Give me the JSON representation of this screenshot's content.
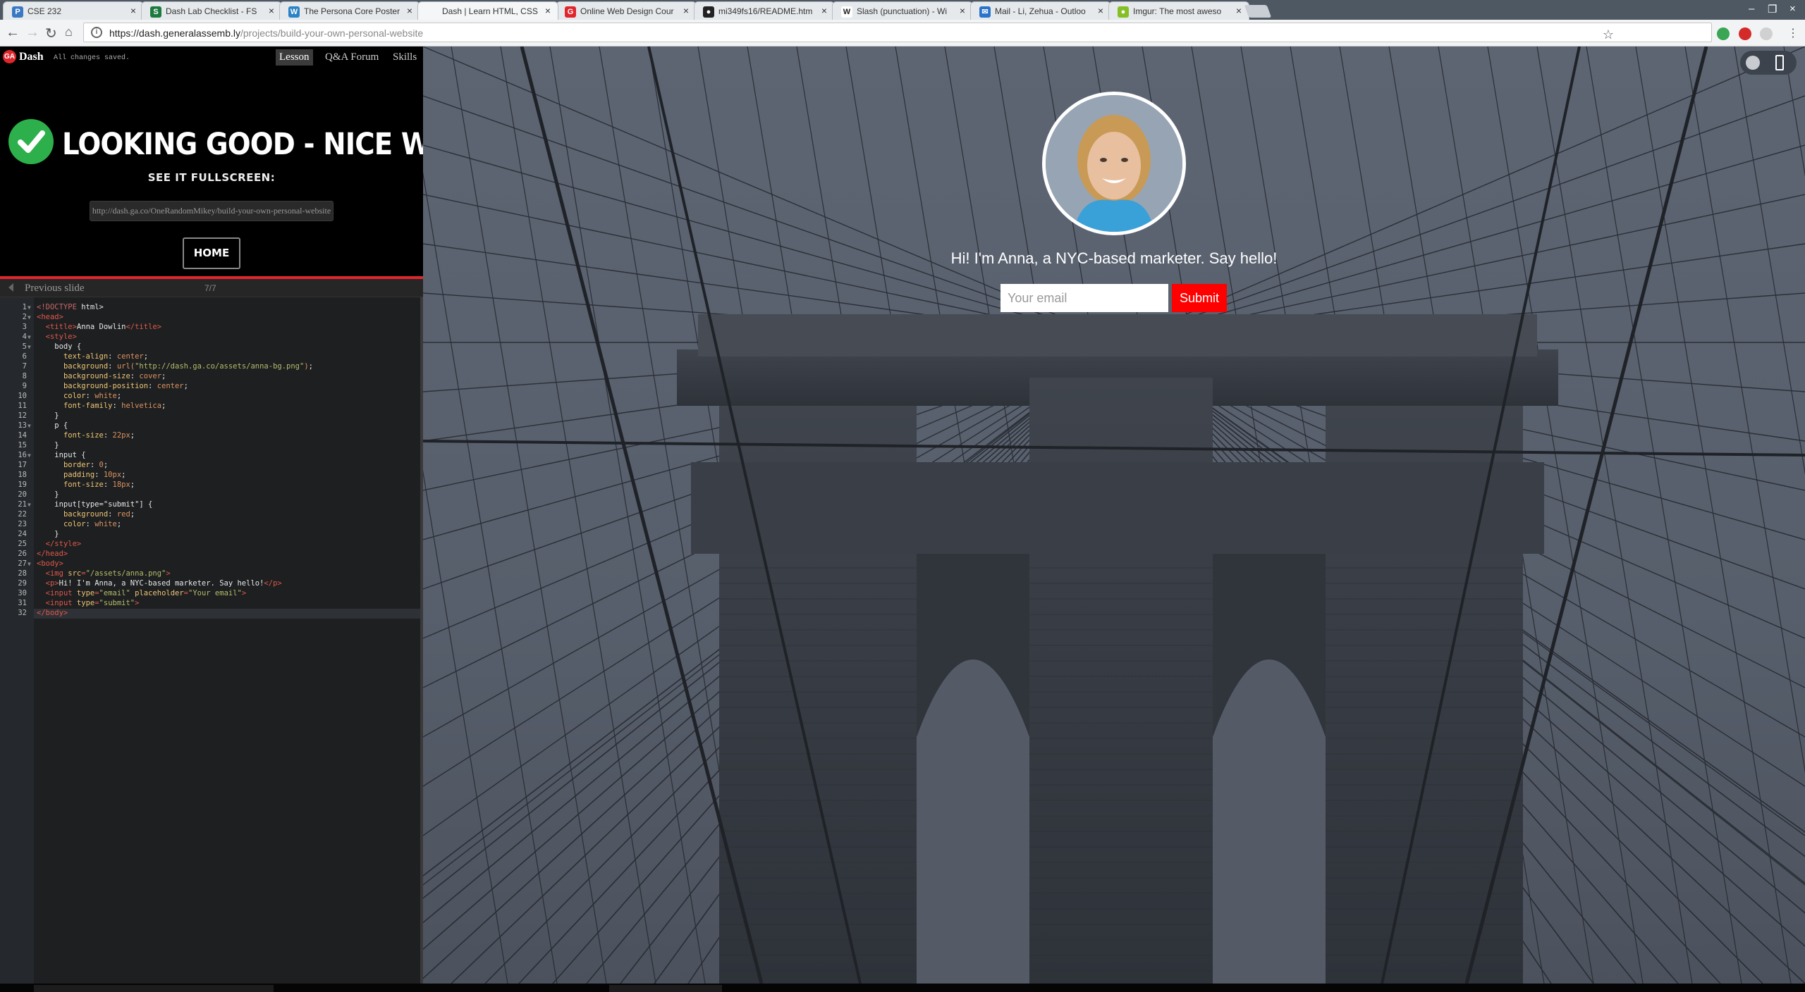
{
  "browser": {
    "tabs": [
      {
        "label": "CSE 232",
        "icon": "p-icon",
        "color": "#3b78c4"
      },
      {
        "label": "Dash Lab Checklist - FS",
        "icon": "s-icon",
        "color": "#1b7a3e"
      },
      {
        "label": "The Persona Core Poster",
        "icon": "wordpress-icon",
        "color": "#2b82c5"
      },
      {
        "label": "Dash | Learn HTML, CSS",
        "icon": "blank-icon",
        "color": "#f5f6f7"
      },
      {
        "label": "Online Web Design Cour",
        "icon": "ga-icon",
        "color": "#e0262d"
      },
      {
        "label": "mi349fs16/README.htm",
        "icon": "github-icon",
        "color": "#222222"
      },
      {
        "label": "Slash (punctuation) - Wi",
        "icon": "wikipedia-icon",
        "color": "#ffffff"
      },
      {
        "label": "Mail - Li, Zehua - Outloo",
        "icon": "mail-icon",
        "color": "#2b74c9"
      },
      {
        "label": "Imgur: The most aweso",
        "icon": "imgur-icon",
        "color": "#85bf25"
      }
    ],
    "url_host": "https://dash.generalassemb.ly",
    "url_path": "/projects/build-your-own-personal-website"
  },
  "lesson": {
    "app_name": "Dash",
    "save_status": "All changes saved.",
    "nav": [
      "Lesson",
      "Q&A Forum",
      "Skills"
    ],
    "headline": "LOOKING GOOD - NICE WORK!",
    "fullscreen_label": "SEE IT FULLSCREEN:",
    "share_url": "http://dash.ga.co/OneRandomMikey/build-your-own-personal-website",
    "home_label": "HOME",
    "prev_label": "Previous slide",
    "slide_count": "7/7"
  },
  "editor": {
    "lines": [
      [
        [
          "t-doc",
          "<!DOCTYPE"
        ],
        [
          "t-txt",
          " html>"
        ]
      ],
      [
        [
          "t-tag",
          "<head>"
        ]
      ],
      [
        [
          "t-txt",
          "  "
        ],
        [
          "t-tag",
          "<title>"
        ],
        [
          "t-txt",
          "Anna Dowlin"
        ],
        [
          "t-tag",
          "</title>"
        ]
      ],
      [
        [
          "t-txt",
          "  "
        ],
        [
          "t-tag",
          "<style>"
        ]
      ],
      [
        [
          "t-txt",
          "    body {"
        ]
      ],
      [
        [
          "t-txt",
          "      "
        ],
        [
          "t-prop",
          "text-align"
        ],
        [
          "t-txt",
          ": "
        ],
        [
          "t-val",
          "center"
        ],
        [
          "t-txt",
          ";"
        ]
      ],
      [
        [
          "t-txt",
          "      "
        ],
        [
          "t-prop",
          "background"
        ],
        [
          "t-txt",
          ": "
        ],
        [
          "t-val",
          "url("
        ],
        [
          "t-str",
          "\"http://dash.ga.co/assets/anna-bg.png\""
        ],
        [
          "t-val",
          ")"
        ],
        [
          "t-txt",
          ";"
        ]
      ],
      [
        [
          "t-txt",
          "      "
        ],
        [
          "t-prop",
          "background-size"
        ],
        [
          "t-txt",
          ": "
        ],
        [
          "t-val",
          "cover"
        ],
        [
          "t-txt",
          ";"
        ]
      ],
      [
        [
          "t-txt",
          "      "
        ],
        [
          "t-prop",
          "background-position"
        ],
        [
          "t-txt",
          ": "
        ],
        [
          "t-val",
          "center"
        ],
        [
          "t-txt",
          ";"
        ]
      ],
      [
        [
          "t-txt",
          "      "
        ],
        [
          "t-prop",
          "color"
        ],
        [
          "t-txt",
          ": "
        ],
        [
          "t-val",
          "white"
        ],
        [
          "t-txt",
          ";"
        ]
      ],
      [
        [
          "t-txt",
          "      "
        ],
        [
          "t-prop",
          "font-family"
        ],
        [
          "t-txt",
          ": "
        ],
        [
          "t-val",
          "helvetica"
        ],
        [
          "t-txt",
          ";"
        ]
      ],
      [
        [
          "t-txt",
          "    }"
        ]
      ],
      [
        [
          "t-txt",
          "    p {"
        ]
      ],
      [
        [
          "t-txt",
          "      "
        ],
        [
          "t-prop",
          "font-size"
        ],
        [
          "t-txt",
          ": "
        ],
        [
          "t-val",
          "22px"
        ],
        [
          "t-txt",
          ";"
        ]
      ],
      [
        [
          "t-txt",
          "    }"
        ]
      ],
      [
        [
          "t-txt",
          "    input {"
        ]
      ],
      [
        [
          "t-txt",
          "      "
        ],
        [
          "t-prop",
          "border"
        ],
        [
          "t-txt",
          ": "
        ],
        [
          "t-val",
          "0"
        ],
        [
          "t-txt",
          ";"
        ]
      ],
      [
        [
          "t-txt",
          "      "
        ],
        [
          "t-prop",
          "padding"
        ],
        [
          "t-txt",
          ": "
        ],
        [
          "t-val",
          "10px"
        ],
        [
          "t-txt",
          ";"
        ]
      ],
      [
        [
          "t-txt",
          "      "
        ],
        [
          "t-prop",
          "font-size"
        ],
        [
          "t-txt",
          ": "
        ],
        [
          "t-val",
          "18px"
        ],
        [
          "t-txt",
          ";"
        ]
      ],
      [
        [
          "t-txt",
          "    }"
        ]
      ],
      [
        [
          "t-txt",
          "    input[type=\"submit\"] {"
        ]
      ],
      [
        [
          "t-txt",
          "      "
        ],
        [
          "t-prop",
          "background"
        ],
        [
          "t-txt",
          ": "
        ],
        [
          "t-val",
          "red"
        ],
        [
          "t-txt",
          ";"
        ]
      ],
      [
        [
          "t-txt",
          "      "
        ],
        [
          "t-prop",
          "color"
        ],
        [
          "t-txt",
          ": "
        ],
        [
          "t-val",
          "white"
        ],
        [
          "t-txt",
          ";"
        ]
      ],
      [
        [
          "t-txt",
          "    }"
        ]
      ],
      [
        [
          "t-txt",
          "  "
        ],
        [
          "t-tag",
          "</style>"
        ]
      ],
      [
        [
          "t-tag",
          "</head>"
        ]
      ],
      [
        [
          "t-tag",
          "<body>"
        ]
      ],
      [
        [
          "t-txt",
          "  "
        ],
        [
          "t-tag",
          "<img "
        ],
        [
          "t-prop",
          "src"
        ],
        [
          "t-tag",
          "="
        ],
        [
          "t-str",
          "\"/assets/anna.png\""
        ],
        [
          "t-tag",
          ">"
        ]
      ],
      [
        [
          "t-txt",
          "  "
        ],
        [
          "t-tag",
          "<p>"
        ],
        [
          "t-txt",
          "Hi! I'm Anna, a NYC-based marketer. Say hello!"
        ],
        [
          "t-tag",
          "</p>"
        ]
      ],
      [
        [
          "t-txt",
          "  "
        ],
        [
          "t-tag",
          "<input "
        ],
        [
          "t-prop",
          "type"
        ],
        [
          "t-tag",
          "="
        ],
        [
          "t-str",
          "\"email\""
        ],
        [
          "t-prop",
          " placeholder"
        ],
        [
          "t-tag",
          "="
        ],
        [
          "t-str",
          "\"Your email\""
        ],
        [
          "t-tag",
          ">"
        ]
      ],
      [
        [
          "t-txt",
          "  "
        ],
        [
          "t-tag",
          "<input "
        ],
        [
          "t-prop",
          "type"
        ],
        [
          "t-tag",
          "="
        ],
        [
          "t-str",
          "\"submit\""
        ],
        [
          "t-tag",
          ">"
        ]
      ],
      [
        [
          "t-tag",
          "</body>"
        ]
      ]
    ],
    "fold_lines": [
      1,
      2,
      4,
      5,
      13,
      16,
      21,
      27
    ]
  },
  "preview": {
    "greeting": "Hi! I'm Anna, a NYC-based marketer. Say hello!",
    "email_placeholder": "Your email",
    "submit_label": "Submit",
    "accent": "#ff0000"
  }
}
